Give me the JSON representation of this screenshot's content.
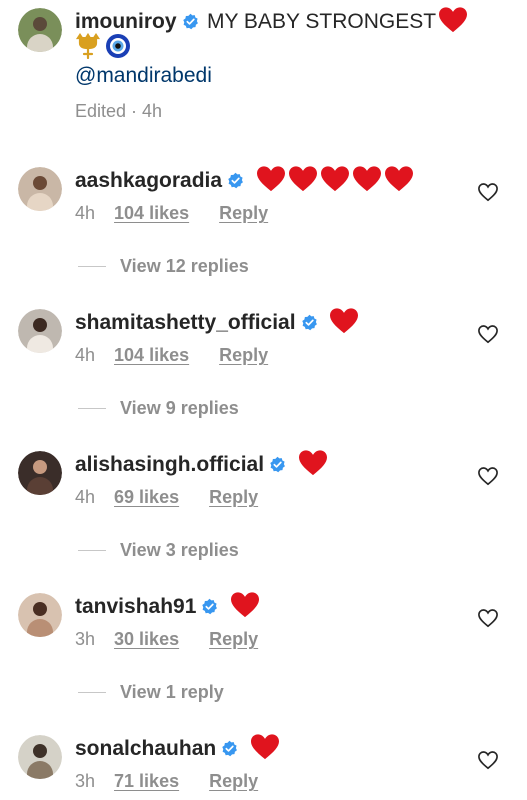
{
  "caption": {
    "username": "imouniroy",
    "text": "MY BABY STRONGEST",
    "mention": "@mandirabedi",
    "edited": "Edited · 4h",
    "emojis": [
      "trident-emoji",
      "nazar-amulet-emoji"
    ]
  },
  "comments": [
    {
      "username": "aashkagoradia",
      "hearts": 5,
      "time": "4h",
      "likes": "104 likes",
      "reply": "Reply",
      "view_replies": "View 12 replies"
    },
    {
      "username": "shamitashetty_official",
      "hearts": 1,
      "time": "4h",
      "likes": "104 likes",
      "reply": "Reply",
      "view_replies": "View 9 replies"
    },
    {
      "username": "alishasingh.official",
      "hearts": 1,
      "time": "4h",
      "likes": "69 likes",
      "reply": "Reply",
      "view_replies": "View 3 replies"
    },
    {
      "username": "tanvishah91",
      "hearts": 1,
      "time": "3h",
      "likes": "30 likes",
      "reply": "Reply",
      "view_replies": "View 1 reply"
    },
    {
      "username": "sonalchauhan",
      "hearts": 1,
      "time": "3h",
      "likes": "71 likes",
      "reply": "Reply"
    }
  ],
  "colors": {
    "text": "#262626",
    "secondary": "#8e8e8e",
    "mention": "#00376b",
    "verified": "#3897f0",
    "heart": "#e0141e"
  },
  "icons": {
    "verified": "verified-badge-icon",
    "like": "heart-outline-icon",
    "heart_emoji": "red-heart-emoji"
  }
}
